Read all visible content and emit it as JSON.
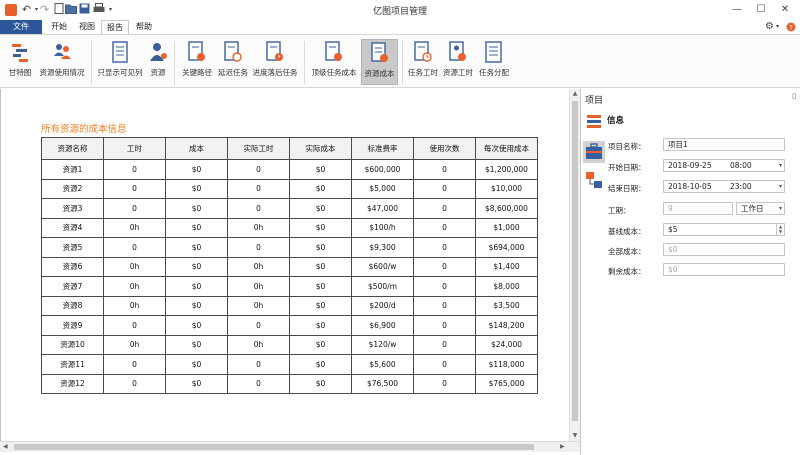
{
  "window": {
    "title": "亿图项目管理",
    "controls": {
      "minimize": "—",
      "maximize": "☐",
      "close": "✕"
    }
  },
  "menu": {
    "tabs": [
      {
        "label": "文件"
      },
      {
        "label": "开始"
      },
      {
        "label": "视图"
      },
      {
        "label": "报告"
      },
      {
        "label": "帮助"
      }
    ],
    "right_icons": [
      "gear-icon",
      "chevron-down-icon",
      "help-icon"
    ]
  },
  "ribbon": {
    "buttons": [
      {
        "label": "甘特图"
      },
      {
        "label": "资源使用情况"
      },
      {
        "label": "只显示可见列"
      },
      {
        "label": "资源"
      },
      {
        "label": "关键路径"
      },
      {
        "label": "延迟任务"
      },
      {
        "label": "进度落后任务"
      },
      {
        "label": "顶级任务成本"
      },
      {
        "label": "资源成本"
      },
      {
        "label": "任务工时"
      },
      {
        "label": "资源工时"
      },
      {
        "label": "任务分配"
      }
    ],
    "active": "资源成本",
    "accent_color": "#e8612c"
  },
  "report": {
    "title": "所有资源的成本信息",
    "title_color": "#f07e1c",
    "columns": [
      "资源名称",
      "工时",
      "成本",
      "实际工时",
      "实际成本",
      "标准费率",
      "使用次数",
      "每次使用成本"
    ],
    "rows": [
      [
        "资源1",
        "0",
        "$0",
        "0",
        "$0",
        "$600,000",
        "0",
        "$1,200,000"
      ],
      [
        "资源2",
        "0",
        "$0",
        "0",
        "$0",
        "$5,000",
        "0",
        "$10,000"
      ],
      [
        "资源3",
        "0",
        "$0",
        "0",
        "$0",
        "$47,000",
        "0",
        "$8,600,000"
      ],
      [
        "资源4",
        "0h",
        "$0",
        "0h",
        "$0",
        "$100/h",
        "0",
        "$1,000"
      ],
      [
        "资源5",
        "0",
        "$0",
        "0",
        "$0",
        "$9,300",
        "0",
        "$694,000"
      ],
      [
        "资源6",
        "0h",
        "$0",
        "0h",
        "$0",
        "$600/w",
        "0",
        "$1,400"
      ],
      [
        "资源7",
        "0h",
        "$0",
        "0h",
        "$0",
        "$500/m",
        "0",
        "$8,000"
      ],
      [
        "资源8",
        "0h",
        "$0",
        "0h",
        "$0",
        "$200/d",
        "0",
        "$3,500"
      ],
      [
        "资源9",
        "0",
        "$0",
        "0",
        "$0",
        "$6,900",
        "0",
        "$148,200"
      ],
      [
        "资源10",
        "0h",
        "$0",
        "0h",
        "$0",
        "$120/w",
        "0",
        "$24,000"
      ],
      [
        "资源11",
        "0",
        "$0",
        "0",
        "$0",
        "$5,600",
        "0",
        "$118,000"
      ],
      [
        "资源12",
        "0",
        "$0",
        "0",
        "$0",
        "$76,500",
        "0",
        "$765,000"
      ]
    ]
  },
  "panel": {
    "title": "项目",
    "section": "信息",
    "fields": {
      "name": {
        "label": "项目名称：",
        "value": "项目1"
      },
      "start": {
        "label": "开始日期：",
        "date": "2018-09-25",
        "time": "08:00"
      },
      "end": {
        "label": "结束日期：",
        "date": "2018-10-05",
        "time": "23:00"
      },
      "duration": {
        "label": "工期：",
        "value": "9",
        "unit": "工作日"
      },
      "baseline_cost": {
        "label": "基线成本：",
        "value": "$5"
      },
      "total_cost": {
        "label": "全部成本：",
        "value": "$0"
      },
      "remaining_cost": {
        "label": "剩余成本：",
        "value": "$0"
      }
    }
  }
}
